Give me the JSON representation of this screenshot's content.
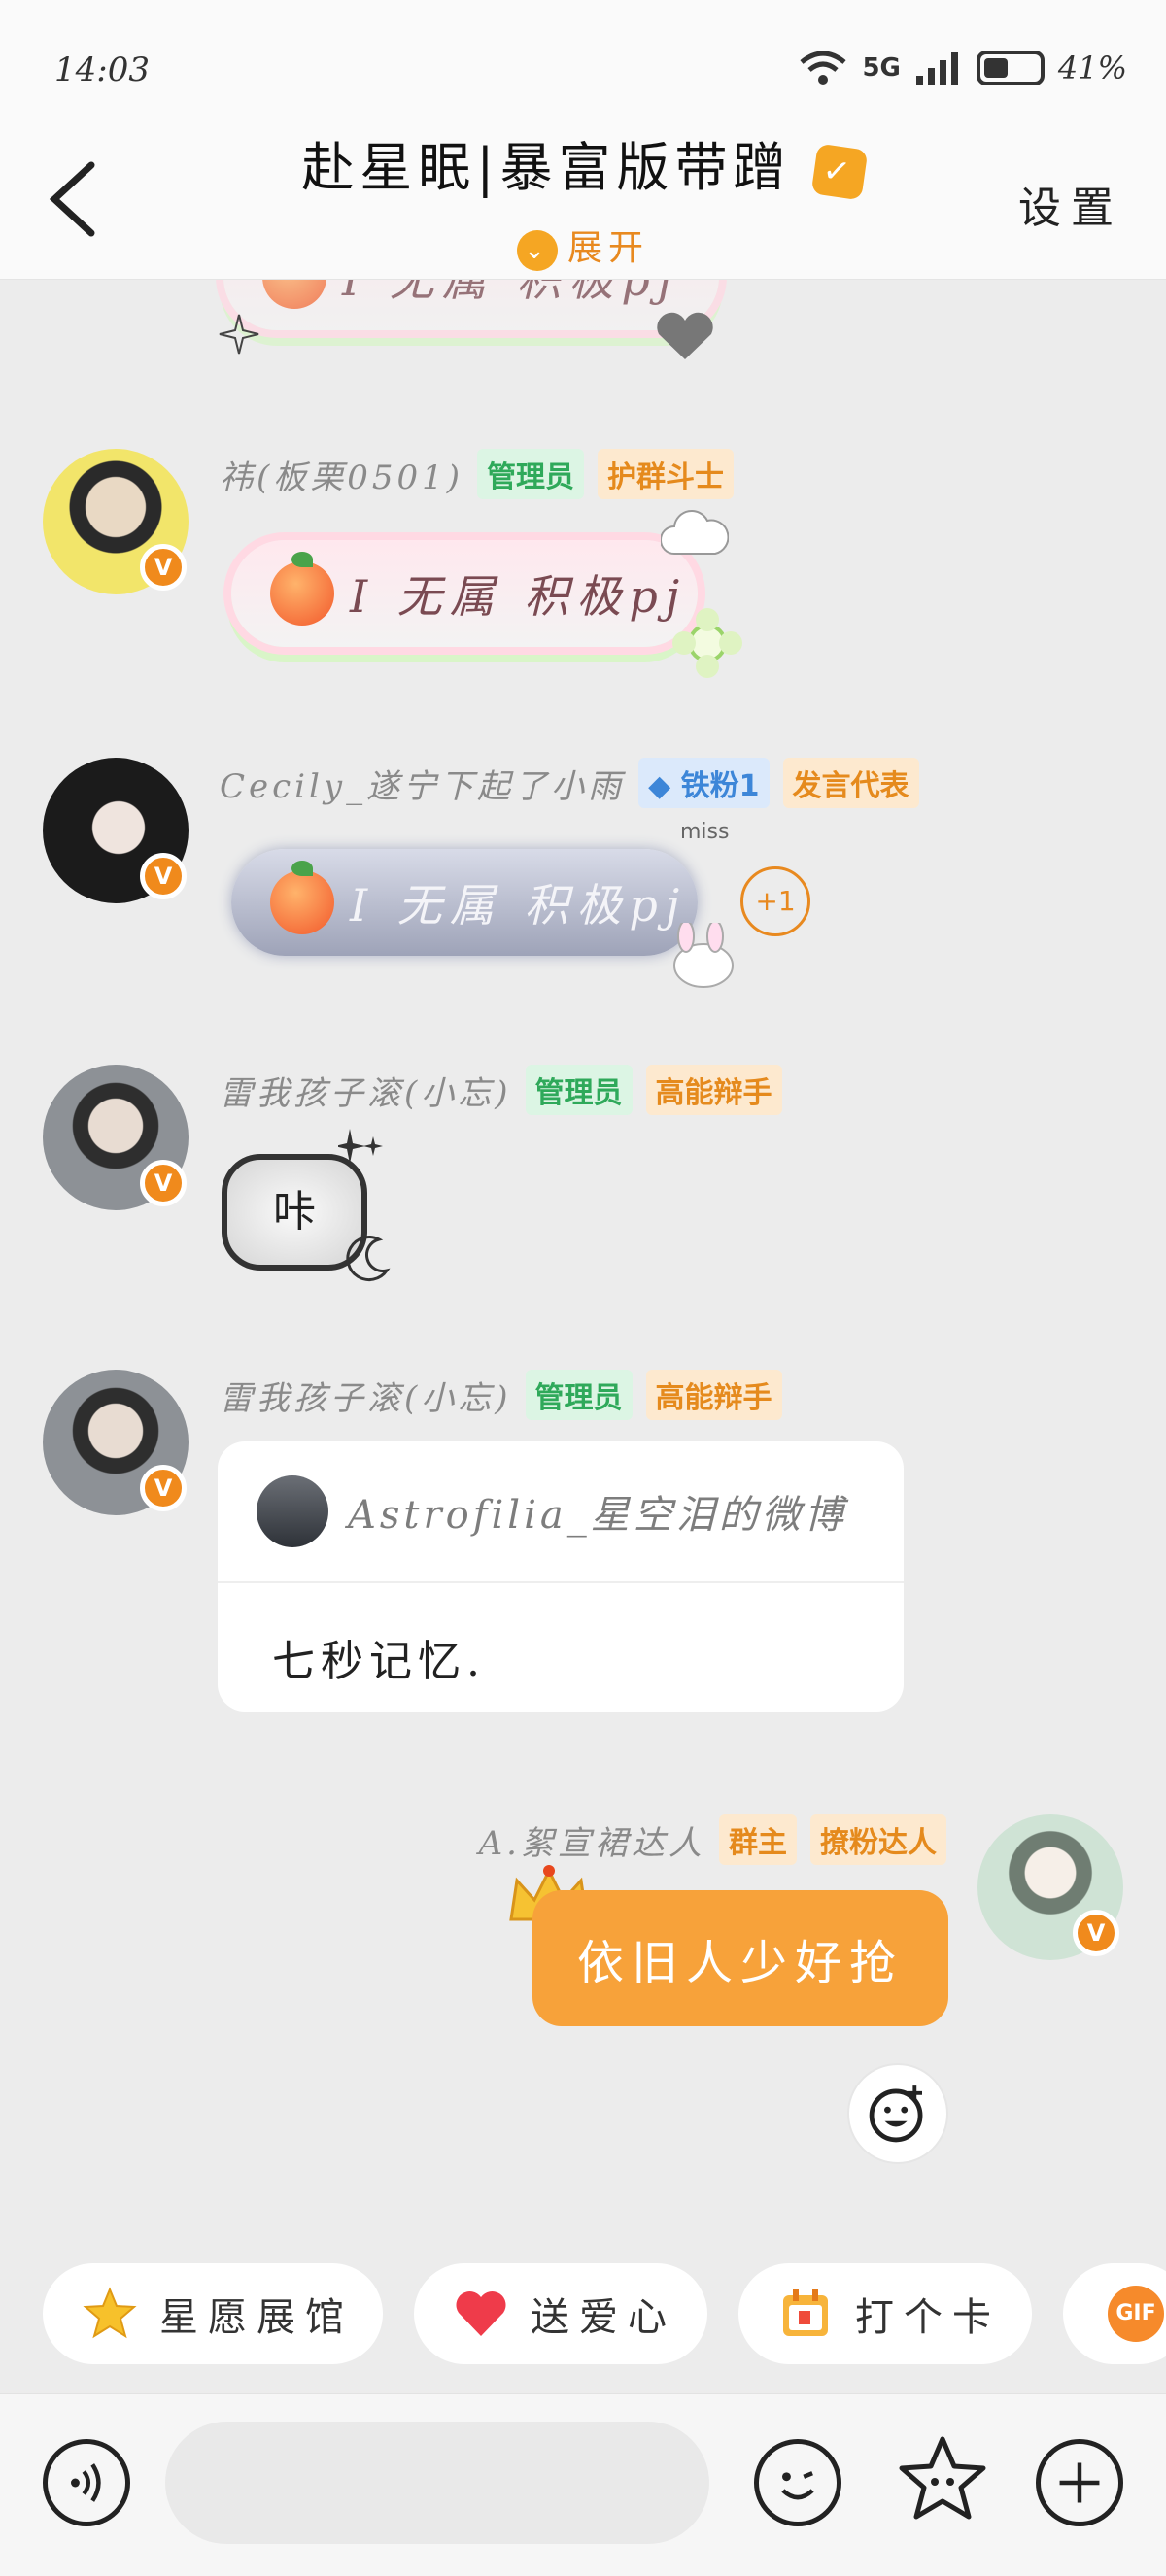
{
  "status": {
    "time": "14:03",
    "network": "5G",
    "battery": "41%"
  },
  "header": {
    "title": "赴星眠|暴富版带蹭",
    "expand_label": "展开",
    "settings_label": "设置"
  },
  "messages": [
    {
      "type": "pj-partial",
      "text": "I 无属 积极pj"
    },
    {
      "user": "祎(板栗0501)",
      "tags": [
        "管理员",
        "护群斗士"
      ],
      "text": "I 无属 积极pj"
    },
    {
      "user": "Cecily_遂宁下起了小雨",
      "tags": [
        "铁粉1",
        "发言代表"
      ],
      "text": "I 无属 积极pj",
      "reaction": "+1",
      "deco_text": "miss"
    },
    {
      "user": "雷我孩子滚(小忘)",
      "tags": [
        "管理员",
        "高能辩手"
      ],
      "text": "咔"
    },
    {
      "user": "雷我孩子滚(小忘)",
      "tags": [
        "管理员",
        "高能辩手"
      ],
      "quote_source": "Astrofilia_星空泪的微博",
      "quote_text": "七秒记忆."
    },
    {
      "user": "A.絮宣裙达人",
      "tags": [
        "群主",
        "撩粉达人"
      ],
      "text": "依旧人少好抢"
    }
  ],
  "quick_actions": [
    "星愿展馆",
    "送爱心",
    "打个卡",
    "GIF"
  ],
  "colors": {
    "accent": "#f7a23a",
    "admin_green": "#2fa95a",
    "tag_orange": "#e58a1d",
    "tag_blue": "#3d86d8"
  }
}
